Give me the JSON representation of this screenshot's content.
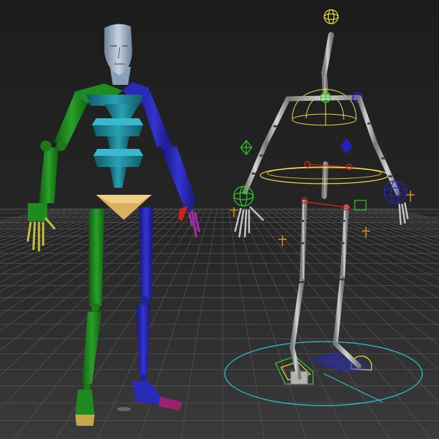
{
  "scene": {
    "type": "3d-viewport-render",
    "background_top": "#1c1c1c",
    "background_bottom": "#3a3a3a",
    "grid_color": "#5a5a5a",
    "colors": {
      "left_limbs": "#1f8a1f",
      "right_limbs": "#2a2ab8",
      "torso": "#1f8a9a",
      "head": "#a7b7cc",
      "pelvis": "#d8b060",
      "left_hand": "#c8c040",
      "right_hand": "#a030b0",
      "rig_bones": "#b4b4b4",
      "rig_yellow": "#f0e040",
      "rig_red": "#cc2222",
      "rig_green": "#30d030",
      "rig_blue": "#2222dd",
      "rig_orange": "#e09020",
      "rig_cyan": "#30c8d8"
    },
    "objects": [
      {
        "name": "mannequin-character",
        "icon": "humanoid-figure"
      },
      {
        "name": "skeleton-rig",
        "icon": "bone-rig"
      },
      {
        "name": "rig-root-circle",
        "icon": "circle-control"
      }
    ]
  }
}
